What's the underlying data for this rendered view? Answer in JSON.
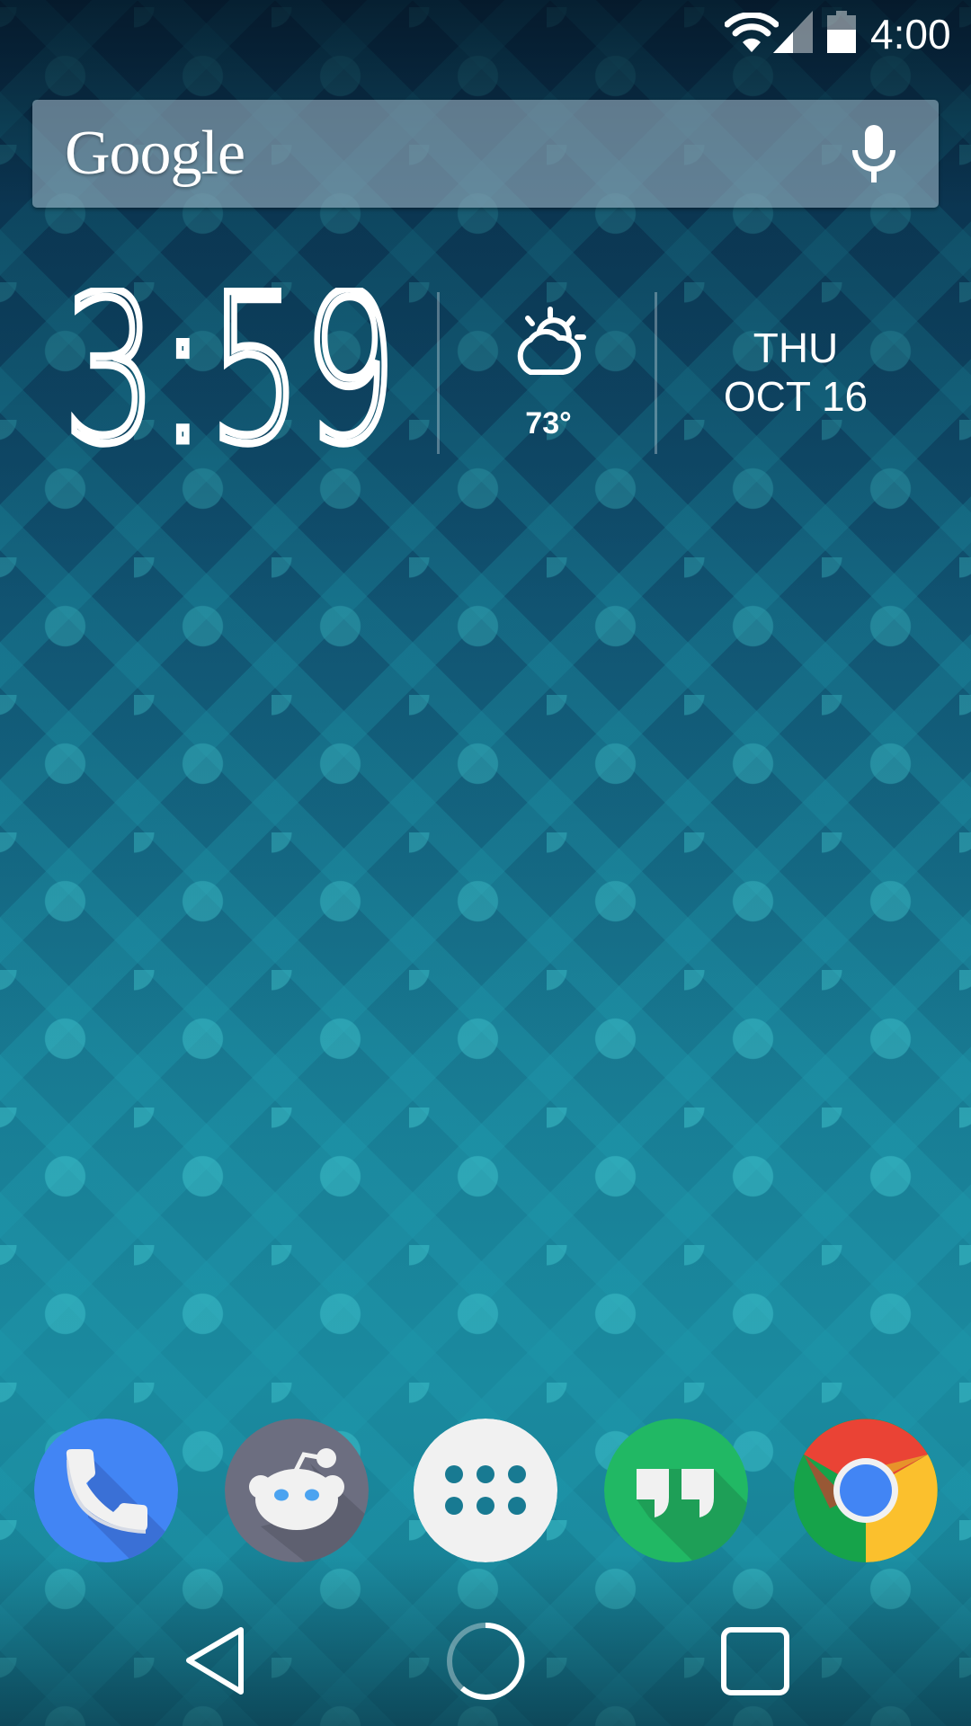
{
  "status_bar": {
    "time": "4:00",
    "icons": [
      "wifi-icon",
      "cell-signal-icon",
      "battery-icon"
    ],
    "signal_bars_filled": 2,
    "signal_bars_total": 4,
    "battery_level_fraction": 0.62
  },
  "search_widget": {
    "logo_text": "Google",
    "mic_icon": "microphone-icon"
  },
  "clock_widget": {
    "time": "3:59",
    "weather_icon": "partly-cloudy-icon",
    "temperature": "73°",
    "day": "THU",
    "date": "OCT 16"
  },
  "dock": {
    "apps": [
      {
        "name": "Phone",
        "icon": "phone-icon",
        "color": "#4285f4"
      },
      {
        "name": "Reddit",
        "icon": "reddit-icon",
        "color": "#6c6e80"
      },
      {
        "name": "App Drawer",
        "icon": "app-drawer-icon",
        "color": "#f1f1f1"
      },
      {
        "name": "Hangouts",
        "icon": "hangouts-icon",
        "color": "#21b864"
      },
      {
        "name": "Chrome",
        "icon": "chrome-icon",
        "color": "#ea4335"
      }
    ]
  },
  "nav_bar": {
    "buttons": [
      "back-icon",
      "home-icon",
      "recents-icon"
    ]
  },
  "colors": {
    "wallpaper_top": "#0d3d5a",
    "wallpaper_bottom": "#1a8a9f",
    "search_bar": "#8aa3b3"
  }
}
